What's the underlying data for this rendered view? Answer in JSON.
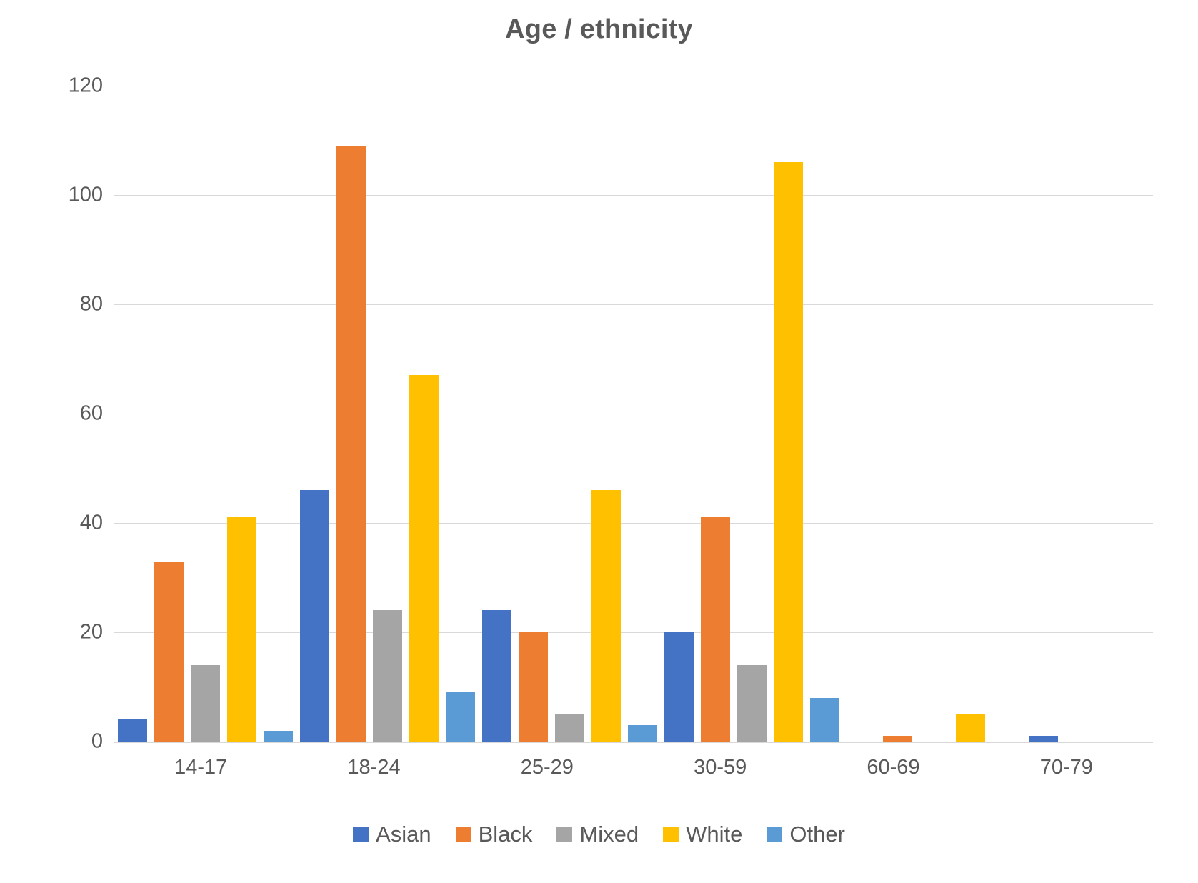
{
  "chart_data": {
    "type": "bar",
    "title": "Age / ethnicity",
    "xlabel": "",
    "ylabel": "",
    "ylim": [
      0,
      120
    ],
    "yticks": [
      0,
      20,
      40,
      60,
      80,
      100,
      120
    ],
    "grid": true,
    "legend_position": "bottom",
    "categories": [
      "14-17",
      "18-24",
      "25-29",
      "30-59",
      "60-69",
      "70-79"
    ],
    "series": [
      {
        "name": "Asian",
        "color": "#4472C4",
        "values": [
          4,
          46,
          24,
          20,
          0,
          1
        ]
      },
      {
        "name": "Black",
        "color": "#ED7D31",
        "values": [
          33,
          109,
          20,
          41,
          1,
          0
        ]
      },
      {
        "name": "Mixed",
        "color": "#A5A5A5",
        "values": [
          14,
          24,
          5,
          14,
          0,
          0
        ]
      },
      {
        "name": "White",
        "color": "#FFC000",
        "values": [
          41,
          67,
          46,
          106,
          5,
          0
        ]
      },
      {
        "name": "Other",
        "color": "#5B9BD5",
        "values": [
          2,
          9,
          3,
          8,
          0,
          0
        ]
      }
    ]
  },
  "style": {
    "text_color": "#595959",
    "gridline_color": "#D9D9D9",
    "background": "#FFFFFF"
  }
}
